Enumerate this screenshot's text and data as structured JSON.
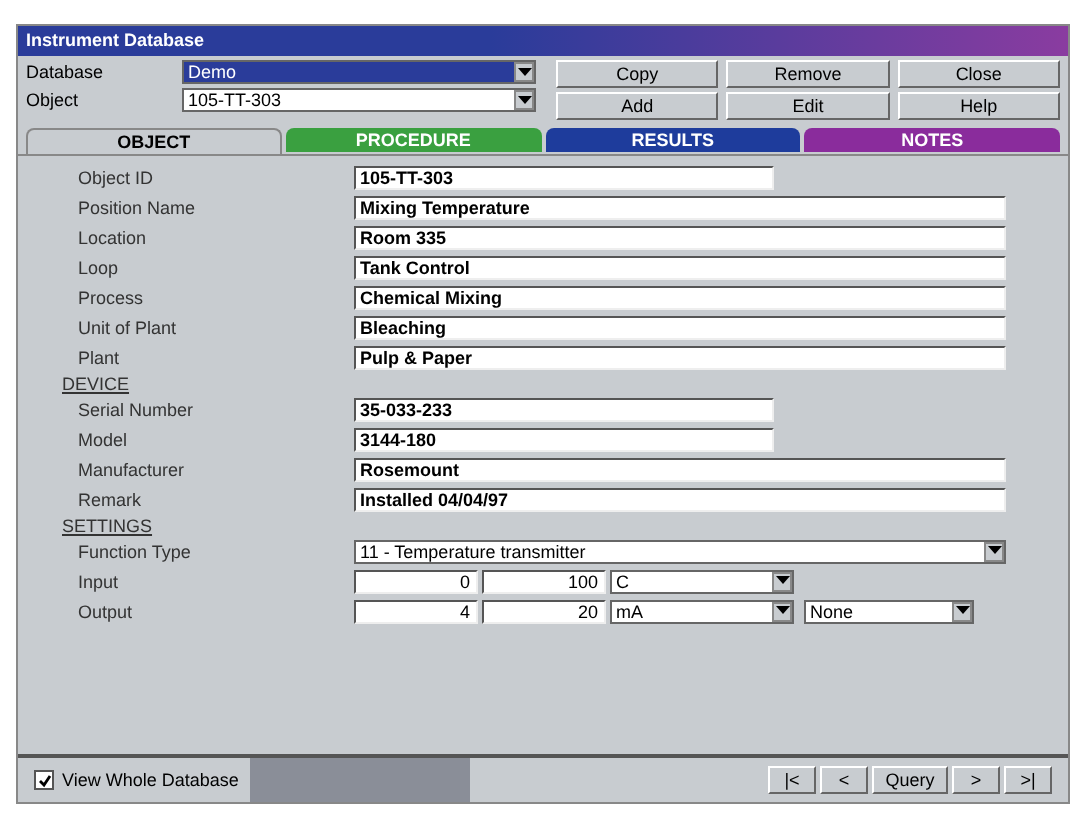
{
  "window": {
    "title": "Instrument Database"
  },
  "selectors": [
    {
      "label": "Database",
      "value": "Demo",
      "highlighted": true
    },
    {
      "label": "Object",
      "value": "105-TT-303",
      "highlighted": false
    }
  ],
  "buttons": [
    "Copy",
    "Remove",
    "Close",
    "Add",
    "Edit",
    "Help"
  ],
  "tabs": [
    {
      "label": "OBJECT",
      "selected": true,
      "color": "#c8ccd0"
    },
    {
      "label": "PROCEDURE",
      "selected": false,
      "color": "#3aa040"
    },
    {
      "label": "RESULTS",
      "selected": false,
      "color": "#1e3c9c"
    },
    {
      "label": "NOTES",
      "selected": false,
      "color": "#8a2c9c"
    }
  ],
  "form": [
    {
      "kind": "short_field",
      "label": "Object ID",
      "value": "105-TT-303"
    },
    {
      "kind": "field",
      "label": "Position Name",
      "value": "Mixing Temperature"
    },
    {
      "kind": "field",
      "label": "Location",
      "value": "Room 335"
    },
    {
      "kind": "field",
      "label": "Loop",
      "value": "Tank Control"
    },
    {
      "kind": "field",
      "label": "Process",
      "value": "Chemical Mixing"
    },
    {
      "kind": "field",
      "label": "Unit of Plant",
      "value": "Bleaching"
    },
    {
      "kind": "field",
      "label": "Plant",
      "value": "Pulp & Paper"
    },
    {
      "kind": "heading",
      "label": "DEVICE"
    },
    {
      "kind": "short_field",
      "label": "Serial Number",
      "value": "35-033-233"
    },
    {
      "kind": "short_field",
      "label": "Model",
      "value": "3144-180"
    },
    {
      "kind": "field",
      "label": "Manufacturer",
      "value": "Rosemount"
    },
    {
      "kind": "field",
      "label": "Remark",
      "value": "Installed 04/04/97"
    },
    {
      "kind": "heading",
      "label": "SETTINGS"
    },
    {
      "kind": "combo",
      "label": "Function Type",
      "value": "11 - Temperature transmitter"
    },
    {
      "kind": "range",
      "label": "Input",
      "low": "0",
      "high": "100",
      "unit": "C"
    },
    {
      "kind": "range",
      "label": "Output",
      "low": "4",
      "high": "20",
      "unit": "mA",
      "extra": "None"
    }
  ],
  "status_bar": {
    "checkbox": {
      "label": "View Whole Database",
      "checked": true
    },
    "nav": [
      "|<",
      "<",
      "Query",
      ">",
      ">|"
    ]
  }
}
